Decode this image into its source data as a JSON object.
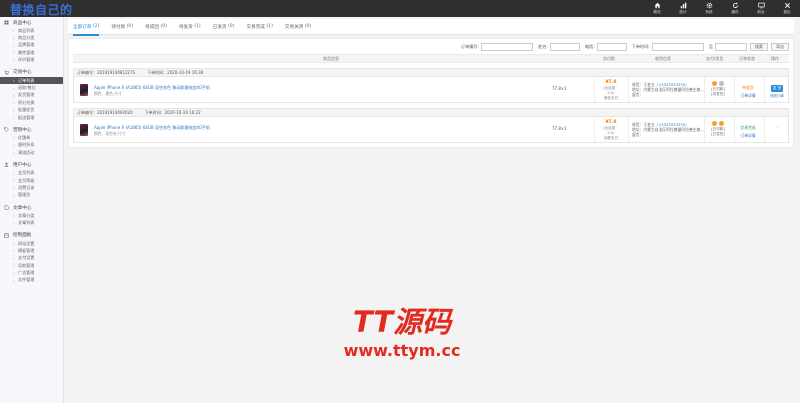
{
  "brand": {
    "title": "替换自己的"
  },
  "topnav": [
    {
      "label": "概况",
      "icon": "home-icon"
    },
    {
      "label": "统计",
      "icon": "bar-chart-icon"
    },
    {
      "label": "系统",
      "icon": "gear-icon"
    },
    {
      "label": "缓存",
      "icon": "refresh-icon"
    },
    {
      "label": "前台",
      "icon": "monitor-icon"
    },
    {
      "label": "退出",
      "icon": "close-icon"
    }
  ],
  "sidebar": [
    {
      "title": "商品中心",
      "icon": "grid-icon",
      "items": [
        "商品列表",
        "商品分类",
        "品牌管理",
        "属性管理",
        "评价管理"
      ]
    },
    {
      "title": "交易中心",
      "icon": "cart-icon",
      "items": [
        "订单列表",
        "退款/售后",
        "发货管理",
        "积分兑换",
        "批量发货",
        "配送管理"
      ],
      "active": "订单列表"
    },
    {
      "title": "营销中心",
      "icon": "tag-icon",
      "items": [
        "优惠券",
        "限时折扣",
        "满减活动"
      ]
    },
    {
      "title": "用户中心",
      "icon": "user-icon",
      "items": [
        "会员列表",
        "会员等级",
        "消费记录",
        "管理员"
      ]
    },
    {
      "title": "文章中心",
      "icon": "file-icon",
      "items": [
        "文章分类",
        "文章列表"
      ]
    },
    {
      "title": "控制面板",
      "icon": "panel-icon",
      "items": [
        "网站设置",
        "模板管理",
        "支付设置",
        "导航管理",
        "广告管理",
        "文件管理"
      ]
    }
  ],
  "tabs": [
    {
      "label": "全部订单",
      "count": "(2)",
      "active": true
    },
    {
      "label": "待付款",
      "count": "(0)"
    },
    {
      "label": "待成团",
      "count": "(0)"
    },
    {
      "label": "待发货",
      "count": "(1)"
    },
    {
      "label": "已发货",
      "count": "(0)"
    },
    {
      "label": "交易完成",
      "count": "(1)"
    },
    {
      "label": "交易关闭",
      "count": "(0)"
    }
  ],
  "filters": {
    "labels": [
      "订单编号:",
      "姓名:",
      "电话:",
      "下单时间:",
      "至"
    ],
    "search_button": "搜索",
    "export_button": "导出"
  },
  "table_headers": [
    "商品信息",
    "实付款",
    "收货信息",
    "支付/发货",
    "订单状态",
    "操作"
  ],
  "orders": [
    {
      "order_no": "订单编号：20191910081227S",
      "order_time": "下单时间：2020-10-19 16:38",
      "product_name": "Apple iPhone X (A1865) 64GB 深空灰色 移动联通电信4G手机",
      "spec": "颜色：黑色·尺寸",
      "qty": "77.8×1",
      "amount": "¥7.8",
      "pay_sub1": "(含运费：0.0)",
      "pay_sub2": "微信支付",
      "buyer": "收货：王老五",
      "phone": "13333333333",
      "address": "地址：内蒙古自治区阿拉善盟阿拉善左旗...",
      "remark": "留言：",
      "pay_status": "[已付款]",
      "ship_status": "[待发货]",
      "state": "待发货",
      "state_color": "#ff7a00",
      "state_sub": "订单详情",
      "op_button": "发 货",
      "op_link": "修改订单"
    },
    {
      "order_no": "订单编号：20191910092020",
      "order_time": "下单时间：2020-10-19 16:22",
      "product_name": "Apple iPhone X (A1865) 64GB 深空灰色 移动联通电信4G手机",
      "spec": "颜色：深空灰·尺寸",
      "qty": "77.8×1",
      "amount": "¥7.8",
      "pay_sub1": "(含运费：0.0)",
      "pay_sub2": "余额支付",
      "buyer": "收货：王老五",
      "phone": "13333333333",
      "address": "地址：内蒙古自治区阿拉善盟阿拉善左旗...",
      "remark": "留言：",
      "pay_status": "[已付款]",
      "ship_status": "[已发货]",
      "state": "交易完成",
      "state_color": "#2aa34a",
      "state_sub": "订单详情",
      "op_dash": "-"
    }
  ],
  "watermark": {
    "line1": "TT源码",
    "line2": "www.ttym.cc"
  }
}
